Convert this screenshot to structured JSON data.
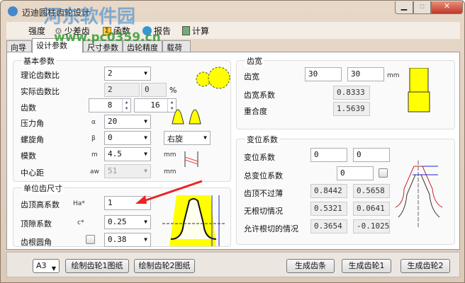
{
  "window": {
    "title": "迈迪圆柱齿轮设计",
    "watermark": "河东软件园",
    "watermark_url": "www.pc0359.cn"
  },
  "toolbar": [
    {
      "label": "强度",
      "icon": "strength-icon"
    },
    {
      "label": "少差齿",
      "icon": "gear-icon"
    },
    {
      "label": "函数",
      "icon": "sigma-icon"
    },
    {
      "label": "报告",
      "icon": "report-icon"
    },
    {
      "label": "计算",
      "icon": "calculator-icon"
    }
  ],
  "tabs": [
    "向导",
    "设计参数",
    "尺寸参数",
    "齿轮精度",
    "载荷"
  ],
  "basic": {
    "title": "基本参数",
    "ratio_label": "理论齿数比",
    "ratio": "2",
    "actual_label": "实际齿数比",
    "actual": "2",
    "actual_pct": "0",
    "pct": "%",
    "teeth_label": "齿数",
    "z1": "8",
    "z2": "16",
    "pressure_label": "压力角",
    "pressure_sym": "α",
    "pressure": "20",
    "helix_label": "螺旋角",
    "helix_sym": "β",
    "helix": "0",
    "helix_dir": "右旋",
    "module_label": "模数",
    "module_sym": "m",
    "module": "4.5",
    "mm": "mm",
    "center_label": "中心距",
    "center_sym": "aw",
    "center": "51"
  },
  "unit": {
    "title": "单位齿尺寸",
    "ha_label": "齿顶高系数",
    "ha_sym": "Ha*",
    "ha": "1",
    "c_label": "顶隙系数",
    "c_sym": "c*",
    "c": "0.25",
    "root_label": "齿根圆角",
    "root": "0.38"
  },
  "width": {
    "title": "齿宽",
    "b_label": "齿宽",
    "b1": "30",
    "b2": "30",
    "mm": "mm",
    "coef_label": "齿宽系数",
    "coef": "0.8333",
    "overlap_label": "重合度",
    "overlap": "1.5639"
  },
  "shift": {
    "title": "变位系数",
    "x_label": "变位系数",
    "x1": "0",
    "x2": "0",
    "sum_label": "总变位系数",
    "sum": "0",
    "tip_label": "齿顶不过薄",
    "tip1": "0.8442",
    "tip2": "0.5658",
    "nocut_label": "无根切情况",
    "nocut1": "0.5321",
    "nocut2": "0.0641",
    "cut_label": "允许根切的情况",
    "cut1": "0.3654",
    "cut2": "-0.1025"
  },
  "bottom": {
    "paper": "A3",
    "draw1": "绘制齿轮1图纸",
    "draw2": "绘制齿轮2图纸",
    "rack": "生成齿条",
    "gear1": "生成齿轮1",
    "gear2": "生成齿轮2"
  }
}
